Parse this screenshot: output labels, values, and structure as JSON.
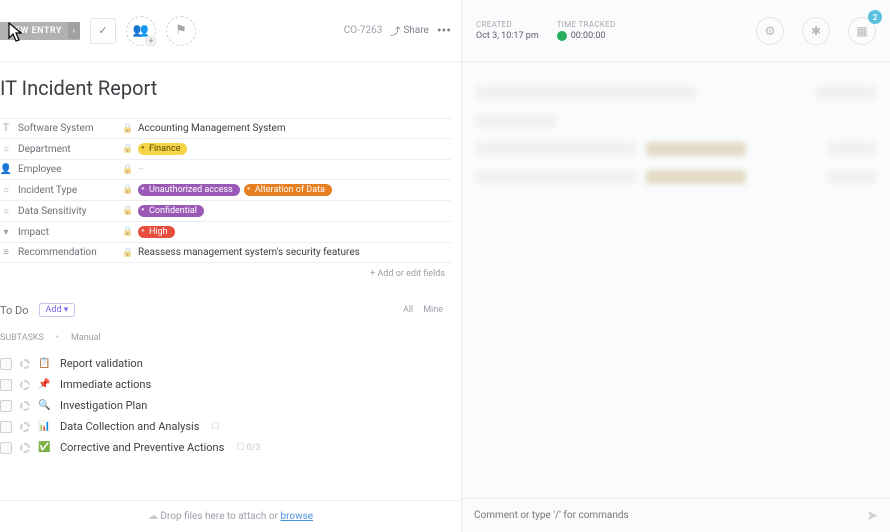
{
  "topbar": {
    "new_entry": "NEW ENTRY",
    "task_id": "CO-7263",
    "share": "Share"
  },
  "meta": {
    "created_label": "CREATED",
    "created_value": "Oct 3, 10:17 pm",
    "time_label": "TIME TRACKED",
    "time_value": "00:00:00",
    "notif_count": "2"
  },
  "page_title": "IT Incident Report",
  "fields": [
    {
      "icon": "T",
      "label": "Software System",
      "value_type": "text",
      "value": "Accounting Management System"
    },
    {
      "icon": "○",
      "label": "Department",
      "value_type": "tag",
      "tags": [
        {
          "text": "Finance",
          "cls": "tag-finance"
        }
      ]
    },
    {
      "icon": "👤",
      "label": "Employee",
      "value_type": "empty"
    },
    {
      "icon": "○",
      "label": "Incident Type",
      "value_type": "tag",
      "tags": [
        {
          "text": "Unauthorized access",
          "cls": "tag-purple"
        },
        {
          "text": "Alteration of Data",
          "cls": "tag-orange"
        }
      ]
    },
    {
      "icon": "○",
      "label": "Data Sensitivity",
      "value_type": "tag",
      "tags": [
        {
          "text": "Confidential",
          "cls": "tag-purple"
        }
      ]
    },
    {
      "icon": "▾",
      "label": "Impact",
      "value_type": "tag",
      "tags": [
        {
          "text": "High",
          "cls": "tag-red"
        }
      ]
    },
    {
      "icon": "≡",
      "label": "Recommendation",
      "value_type": "text",
      "value": "Reassess management system's security features"
    }
  ],
  "add_fields": "+ Add or edit fields",
  "todo": {
    "title": "To Do",
    "add": "Add ▾",
    "tabs": {
      "all": "All",
      "mine": "Mine"
    },
    "subtasks_label": "SUBTASKS",
    "manual": "Manual",
    "items": [
      {
        "icon": "📋",
        "color": "#d4a017",
        "label": "Report validation",
        "meta": ""
      },
      {
        "icon": "📌",
        "color": "#4a90e2",
        "label": "Immediate actions",
        "meta": ""
      },
      {
        "icon": "🔍",
        "color": "#4a90e2",
        "label": "Investigation Plan",
        "meta": ""
      },
      {
        "icon": "📊",
        "color": "#7b68ee",
        "label": "Data Collection and Analysis",
        "meta": "☐"
      },
      {
        "icon": "✅",
        "color": "#27ae60",
        "label": "Corrective and Preventive Actions",
        "meta": "☐ 0/3"
      }
    ]
  },
  "drop": {
    "prefix": "Drop files here to attach or ",
    "link": "browse"
  },
  "comment": {
    "placeholder": "Comment or type '/' for commands"
  }
}
